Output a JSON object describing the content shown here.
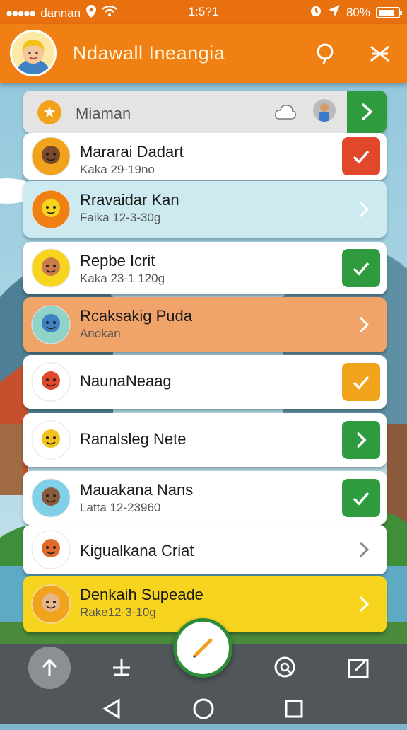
{
  "status_bar": {
    "carrier": "dannan",
    "time": "1:5?1",
    "battery_text": "80%",
    "battery_level": 0.8
  },
  "header": {
    "title": "Ndawall Ineangia"
  },
  "search": {
    "text": "Miaman"
  },
  "items": [
    {
      "name": "Mararai Dadart",
      "sub": "Kaka 29-19no",
      "action": "check",
      "action_color": "#e0472b",
      "bg": "#ffffff"
    },
    {
      "name": "Rravaidar Kan",
      "sub": "Faika 12-3-30g",
      "action": "chevron",
      "action_color": "",
      "bg": "#cdeaf0"
    },
    {
      "name": "Repbe Icrit",
      "sub": "Kaka 23-1 120g",
      "action": "check",
      "action_color": "#2e9b3f",
      "bg": "#ffffff"
    },
    {
      "name": "Rcaksakig Puda",
      "sub": "Anokan",
      "action": "chevron",
      "action_color": "",
      "bg": "#f0a46a"
    },
    {
      "name": "NaunaNeaag",
      "sub": "",
      "action": "check",
      "action_color": "#f2a31c",
      "bg": "#ffffff"
    },
    {
      "name": "Ranalsleg Nete",
      "sub": "",
      "action": "chevron-box",
      "action_color": "#2e9b3f",
      "bg": "#ffffff"
    },
    {
      "name": "Mauakana Nans",
      "sub": "Latta 12-23960",
      "action": "check",
      "action_color": "#2e9b3f",
      "bg": "#ffffff"
    },
    {
      "name": "Kigualkana Criat",
      "sub": "",
      "action": "chevron",
      "action_color": "",
      "bg": "#ffffff"
    },
    {
      "name": "Denkaih Supeade",
      "sub": "Rake12-3-10g",
      "action": "chevron",
      "action_color": "",
      "bg": "#f7d51f"
    }
  ],
  "colors": {
    "accent": "#f07f14",
    "success": "#2e9b3f",
    "danger": "#e0472b",
    "warning": "#f2a31c"
  }
}
